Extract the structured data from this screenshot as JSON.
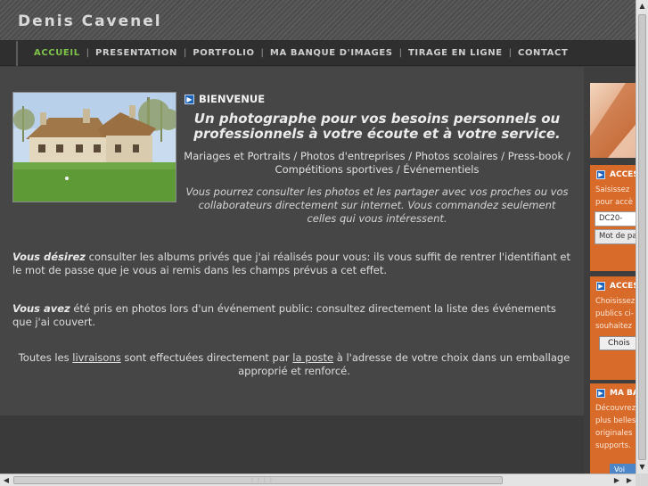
{
  "site": {
    "title": "Denis Cavenel"
  },
  "nav": {
    "items": [
      {
        "label": "ACCUEIL",
        "active": true
      },
      {
        "label": "PRESENTATION"
      },
      {
        "label": "PORTFOLIO"
      },
      {
        "label": "MA BANQUE D'IMAGES"
      },
      {
        "label": "TIRAGE EN LIGNE"
      },
      {
        "label": "CONTACT"
      }
    ],
    "separator": "|",
    "active_color": "#7ec34a"
  },
  "main": {
    "welcome_icon": "arrow-right-icon",
    "welcome": "BIENVENUE",
    "tagline": "Un photographe pour vos besoins personnels ou professionnels à votre écoute et à votre service.",
    "services": "Mariages et Portraits / Photos d'entreprises / Photos scolaires / Press-book / Compétitions sportives / Événementiels",
    "consult": "Vous pourrez consulter les photos et les partager avec vos proches ou vos collaborateurs directement sur internet. Vous commandez seulement celles qui vous intéressent.",
    "para1_strong": "Vous désirez",
    "para1_rest": " consulter les albums privés que j'ai réalisés pour vous: ils vous suffit de rentrer l'identifiant et le mot de passe que je vous ai remis dans les champs prévus a cet effet.",
    "para2_strong": "Vous avez",
    "para2_rest": " été pris en photos lors d'un événement public: consultez directement la liste des événements que j'ai couvert.",
    "delivery_pre": "Toutes les ",
    "delivery_link1": "livraisons",
    "delivery_mid": " sont effectuées directement par ",
    "delivery_link2": "la poste",
    "delivery_post": " à l'adresse de votre choix dans un emballage approprié et renforcé."
  },
  "sidebar": {
    "box1": {
      "title": "ACCES",
      "line1": "Saisissez",
      "line2": "pour accè",
      "login_value": "DC20-",
      "password_placeholder": "Mot de pa"
    },
    "box2": {
      "title": "ACCES",
      "line1": "Choisissez",
      "line2": "publics ci-",
      "line3": "souhaitez",
      "button": "Chois"
    },
    "box3": {
      "title": "MA BA",
      "line1": "Découvrez",
      "line2": "plus belles",
      "line3": "originales",
      "line4": "supports.",
      "button": "Voi"
    },
    "box_color": "#d86a2a"
  },
  "scrollbars": {
    "up": "▲",
    "down": "▼",
    "left": "◀",
    "right": "▶",
    "grip": "⋮⋮⋮⋮"
  },
  "colors": {
    "background": "#464646",
    "nav_background": "#2f2f2f",
    "icon_blue": "#1d63b8"
  }
}
